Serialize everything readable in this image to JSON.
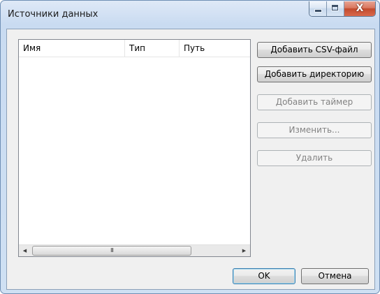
{
  "window": {
    "title": "Источники данных",
    "caption_buttons": {
      "minimize_icon": "minimize-icon",
      "maximize_icon": "maximize-icon",
      "close_icon": "close-icon",
      "close_glyph": "X"
    }
  },
  "list": {
    "columns": [
      "Имя",
      "Тип",
      "Путь"
    ],
    "rows": [],
    "scrollbar": {
      "left_arrow": "◀",
      "right_arrow": "▶",
      "grip": "III"
    }
  },
  "actions": {
    "add_csv": {
      "label": "Добавить CSV-файл",
      "enabled": true
    },
    "add_directory": {
      "label": "Добавить директорию",
      "enabled": true
    },
    "add_timer": {
      "label": "Добавить таймер",
      "enabled": false
    },
    "edit": {
      "label": "Изменить...",
      "enabled": false
    },
    "delete": {
      "label": "Удалить",
      "enabled": false
    }
  },
  "footer": {
    "ok_label": "OK",
    "cancel_label": "Отмена"
  },
  "colors": {
    "frame": "#cfe0f3",
    "client": "#f0f0f0",
    "close_button": "#c24a2d",
    "default_button_border": "#3c7fb1",
    "disabled_text": "#838383"
  }
}
